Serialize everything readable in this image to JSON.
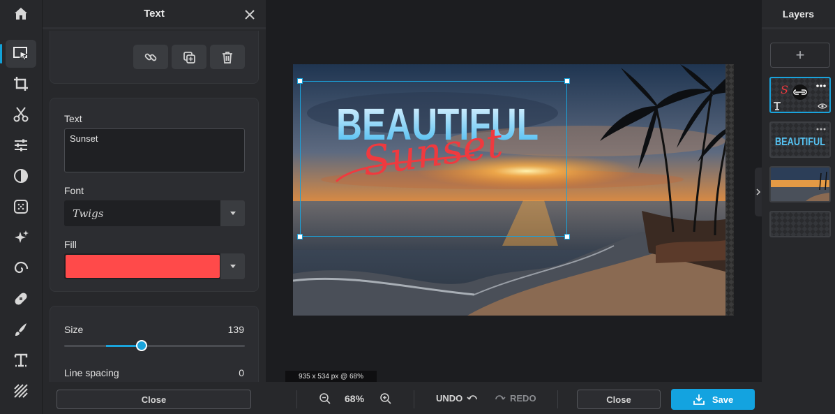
{
  "panel": {
    "title": "Text",
    "text_label": "Text",
    "text_value": "Sunset",
    "font_label": "Font",
    "font_name": "Twigs",
    "fill_label": "Fill",
    "fill_color": "#ff4a4a",
    "size_label": "Size",
    "size_value": "139",
    "size_fraction": 0.43,
    "line_spacing_label": "Line spacing",
    "line_spacing_value": "0",
    "close_label": "Close"
  },
  "canvas": {
    "dimensions_label": "935 x 534 px @ 68%",
    "headline": "BEAUTIFUL",
    "script_text": "Sunset"
  },
  "layers": {
    "title": "Layers",
    "add_label": "+",
    "thumb_text": "BEAUTIFUL"
  },
  "toolbar": {
    "zoom": "68%",
    "undo": "UNDO",
    "redo": "REDO",
    "close": "Close",
    "save": "Save"
  },
  "colors": {
    "accent": "#13a3e0",
    "fill": "#ff4a4a"
  },
  "icons": [
    "home-icon",
    "select-icon",
    "crop-icon",
    "cut-icon",
    "adjust-icon",
    "contrast-icon",
    "texture-icon",
    "sparkle-icon",
    "swirl-icon",
    "bandage-icon",
    "brush-icon",
    "text-tool-icon",
    "pattern-icon"
  ]
}
